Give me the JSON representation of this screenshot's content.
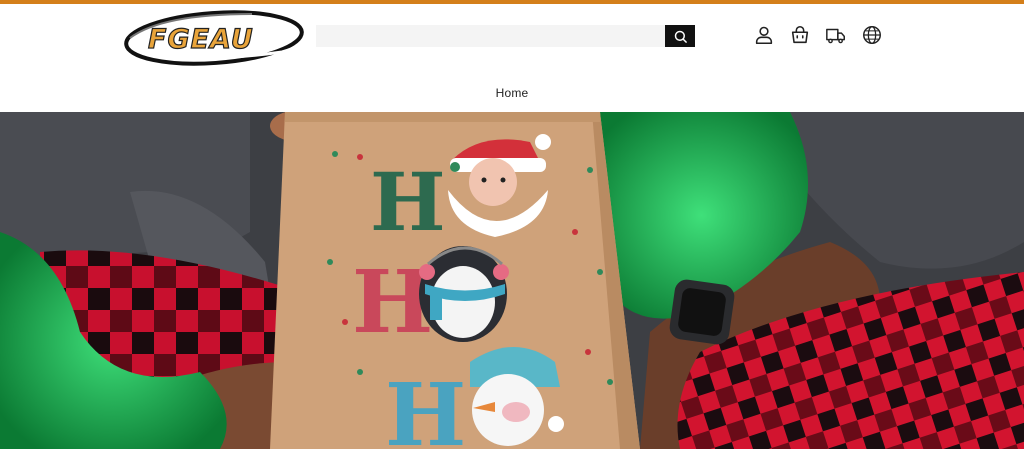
{
  "colors": {
    "accent_bar": "#d47f1a",
    "logo_fill": "#e9a43a",
    "search_button": "#111111"
  },
  "brand": {
    "logo_text": "FGEAU"
  },
  "search": {
    "value": "",
    "placeholder": "",
    "button_icon": "search-icon"
  },
  "header_icons": [
    {
      "name": "account",
      "icon": "user-icon"
    },
    {
      "name": "cart",
      "icon": "shopping-bag-icon"
    },
    {
      "name": "order-tracking",
      "icon": "delivery-truck-icon"
    },
    {
      "name": "language",
      "icon": "globe-icon"
    }
  ],
  "nav": {
    "items": [
      {
        "label": "Home"
      }
    ]
  },
  "hero": {
    "image": "holiday-gift-bag-photo",
    "bag_text": [
      "H",
      "O",
      "H",
      "O",
      "H",
      "O"
    ]
  }
}
